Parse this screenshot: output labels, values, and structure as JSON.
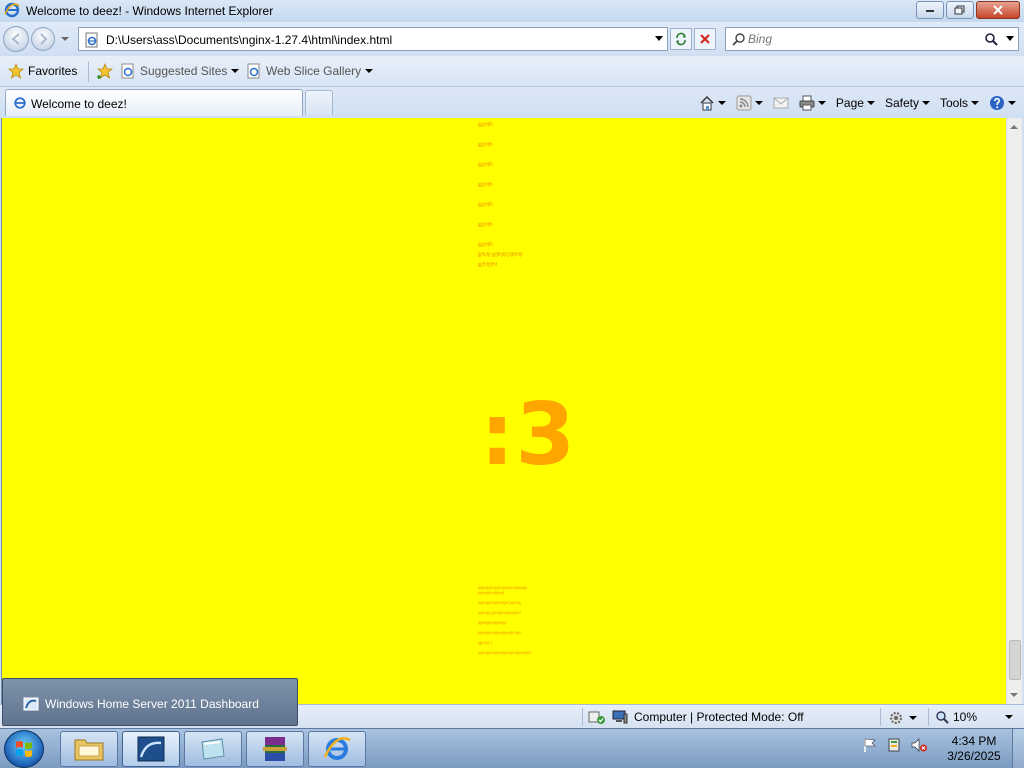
{
  "window": {
    "title": "Welcome to deez! - Windows Internet Explorer"
  },
  "navigation": {
    "address": "D:\\Users\\ass\\Documents\\nginx-1.27.4\\html\\index.html",
    "search_placeholder": "Bing"
  },
  "favorites_bar": {
    "favorites_label": "Favorites",
    "suggested_sites_label": "Suggested Sites",
    "web_slice_gallery_label": "Web Slice Gallery"
  },
  "tabs": [
    {
      "label": "Welcome to deez!"
    }
  ],
  "command_bar": {
    "page_label": "Page",
    "safety_label": "Safety",
    "tools_label": "Tools"
  },
  "content": {
    "small_lines": [
      "jjjjjhfjfh",
      "jjjjjhfjfh",
      "jjjjjhfjfh",
      "jjjjjhfjfh",
      "jjjjjhfjfh",
      "jjjjjhfjfh",
      "jjjjjhfjfh",
      "jjjfhjfjf  jjjfjfhjfjf jfjfjfhfjf",
      "jjjjfhfjfjfhf"
    ],
    "big_text": ":3",
    "bottom_paragraphs": [
      "jfjfjfhfjjfjfhfjfjfhfjfhfjfjfhfjfjfhfjfjf jfjfjfhfjfjfhfjfjfhfjf",
      "jfjfjfhfjfjfhfjfjfhfjfjfhf jfjfhfjfj",
      "jfjfjfhfjfj jfjfhfjfjfhfjfjfhfjfjfhf",
      "jfjfjfhfjfjfhfjfjfhfjfjf",
      "jfjfjfhfjfjfhfjfjfhfjfjfhfjfjfhfjfjf",
      "jjjjjhfjfh j",
      "jfjfjfhfjfjfhfjfjfhfjfjfhfjfjfhfjfjfhfjfjfhf"
    ]
  },
  "status_bar": {
    "zone_text": "Computer | Protected Mode: Off",
    "zoom_text": "10%"
  },
  "jump_list": {
    "item_label": "Windows Home Server 2011 Dashboard"
  },
  "taskbar": {
    "time": "4:34 PM",
    "date": "3/26/2025"
  }
}
